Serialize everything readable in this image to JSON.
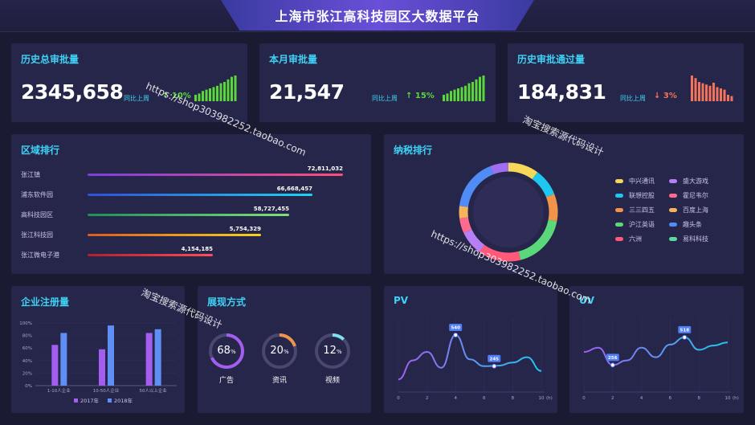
{
  "header": {
    "title": "上海市张江高科技园区大数据平台"
  },
  "kpis": [
    {
      "title": "历史总审批量",
      "value": "2345,658",
      "compare_label": "同比上周",
      "change": "10%",
      "direction": "up",
      "color": "#5ad83a",
      "spark": [
        0.25,
        0.3,
        0.4,
        0.45,
        0.5,
        0.55,
        0.6,
        0.7,
        0.75,
        0.85,
        0.95,
        1.0
      ]
    },
    {
      "title": "本月审批量",
      "value": "21,547",
      "compare_label": "同比上周",
      "change": "15%",
      "direction": "up",
      "color": "#5ad83a",
      "spark": [
        0.25,
        0.3,
        0.4,
        0.45,
        0.5,
        0.55,
        0.6,
        0.7,
        0.75,
        0.85,
        0.95,
        1.0
      ]
    },
    {
      "title": "历史审批通过量",
      "value": "184,831",
      "compare_label": "同比上周",
      "change": "3%",
      "direction": "down",
      "color": "#f2745a",
      "spark": [
        1.0,
        0.9,
        0.75,
        0.7,
        0.65,
        0.6,
        0.72,
        0.55,
        0.5,
        0.45,
        0.25,
        0.2
      ]
    }
  ],
  "region_rank": {
    "title": "区域排行",
    "items": [
      {
        "name": "张江镇",
        "value": "72,811,032",
        "fraction": 1.0,
        "colors": [
          "#7a3fe0",
          "#ff4d7a"
        ]
      },
      {
        "name": "浦东软件园",
        "value": "66,668,457",
        "fraction": 0.88,
        "colors": [
          "#2f4fd8",
          "#1ed3f0"
        ]
      },
      {
        "name": "高科技园区",
        "value": "58,727,455",
        "fraction": 0.79,
        "colors": [
          "#1e8f5a",
          "#7fe07a"
        ]
      },
      {
        "name": "张江科技园",
        "value": "5,754,329",
        "fraction": 0.68,
        "colors": [
          "#e05a1e",
          "#f5d31e"
        ]
      },
      {
        "name": "张江微电子港",
        "value": "4,154,185",
        "fraction": 0.49,
        "colors": [
          "#b0202a",
          "#ff4d5a"
        ]
      }
    ]
  },
  "tax_rank": {
    "title": "纳税排行",
    "legend": [
      {
        "name": "中兴通讯",
        "color": "#f5d75a"
      },
      {
        "name": "盛大游戏",
        "color": "#b77ef5"
      },
      {
        "name": "联想控股",
        "color": "#1ec7f0"
      },
      {
        "name": "霍尼韦尔",
        "color": "#ff6b8e"
      },
      {
        "name": "三三四五",
        "color": "#f2934a"
      },
      {
        "name": "百度上海",
        "color": "#f5b45a"
      },
      {
        "name": "沪江英语",
        "color": "#5ad87a"
      },
      {
        "name": "趣头条",
        "color": "#4f8cf5"
      },
      {
        "name": "六洲",
        "color": "#ff5a7a"
      },
      {
        "name": "易科科技",
        "color": "#5ad8a0"
      }
    ],
    "ring_segments": [
      {
        "color": "#f5d75a",
        "value": 10
      },
      {
        "color": "#1ec7f0",
        "value": 9
      },
      {
        "color": "#f2934a",
        "value": 9
      },
      {
        "color": "#5ad87a",
        "value": 18
      },
      {
        "color": "#ff5a7a",
        "value": 14
      },
      {
        "color": "#b77ef5",
        "value": 8
      },
      {
        "color": "#ff6b8e",
        "value": 5
      },
      {
        "color": "#f5b45a",
        "value": 4
      },
      {
        "color": "#4f8cf5",
        "value": 17
      },
      {
        "color": "#a06ef0",
        "value": 6
      }
    ]
  },
  "enterprise": {
    "title": "企业注册量",
    "chart_data": {
      "type": "bar",
      "categories": [
        "1-10人企业",
        "10-50人企业",
        "50人以上企业"
      ],
      "series": [
        {
          "name": "2017年",
          "values": [
            0.65,
            0.58,
            0.84
          ],
          "color": "#a35ef0"
        },
        {
          "name": "2018年",
          "values": [
            0.84,
            0.96,
            0.9
          ],
          "color": "#5f8ef5"
        }
      ],
      "yticks": [
        "0%",
        "20%",
        "40%",
        "60%",
        "80%",
        "100%"
      ],
      "ylim": [
        0,
        1
      ]
    }
  },
  "display_modes": {
    "title": "展现方式",
    "items": [
      {
        "pct": "68",
        "unit": "%",
        "label": "广告",
        "fraction": 0.68,
        "color": "#a35ef0"
      },
      {
        "pct": "20",
        "unit": "%",
        "label": "资讯",
        "fraction": 0.2,
        "color": "#f2934a"
      },
      {
        "pct": "12",
        "unit": "%",
        "label": "视频",
        "fraction": 0.12,
        "color": "#7fe0f0"
      }
    ]
  },
  "pv": {
    "title": "PV",
    "chart_data": {
      "type": "line",
      "x": [
        0,
        1,
        2,
        3,
        4,
        5,
        6,
        7,
        8,
        9,
        10
      ],
      "values": [
        120,
        300,
        380,
        230,
        540,
        310,
        245,
        250,
        280,
        330,
        200
      ],
      "ylim": [
        0,
        700
      ],
      "xticks": [
        "0",
        "2",
        "4",
        "6",
        "8",
        "10"
      ],
      "unit": "(h)",
      "annotations": [
        {
          "x": 4,
          "label": "540"
        },
        {
          "x": 6.7,
          "label": "245"
        }
      ]
    }
  },
  "uv": {
    "title": "UV",
    "chart_data": {
      "type": "line",
      "x": [
        0,
        1,
        2,
        3,
        4,
        5,
        6,
        7,
        8,
        9,
        10
      ],
      "values": [
        380,
        420,
        256,
        300,
        420,
        330,
        450,
        518,
        400,
        440,
        470
      ],
      "ylim": [
        0,
        700
      ],
      "xticks": [
        "0",
        "2",
        "4",
        "6",
        "8",
        "10"
      ],
      "unit": "(h)",
      "annotations": [
        {
          "x": 2,
          "label": "256"
        },
        {
          "x": 7,
          "label": "518"
        }
      ]
    }
  },
  "watermarks": {
    "url1": "https://shop303982252.taobao.com",
    "cn1": "淘宝搜索源代码设计",
    "url2": "https://shop303982252.taobao.com",
    "cn2": "淘宝搜索源代码设计"
  }
}
